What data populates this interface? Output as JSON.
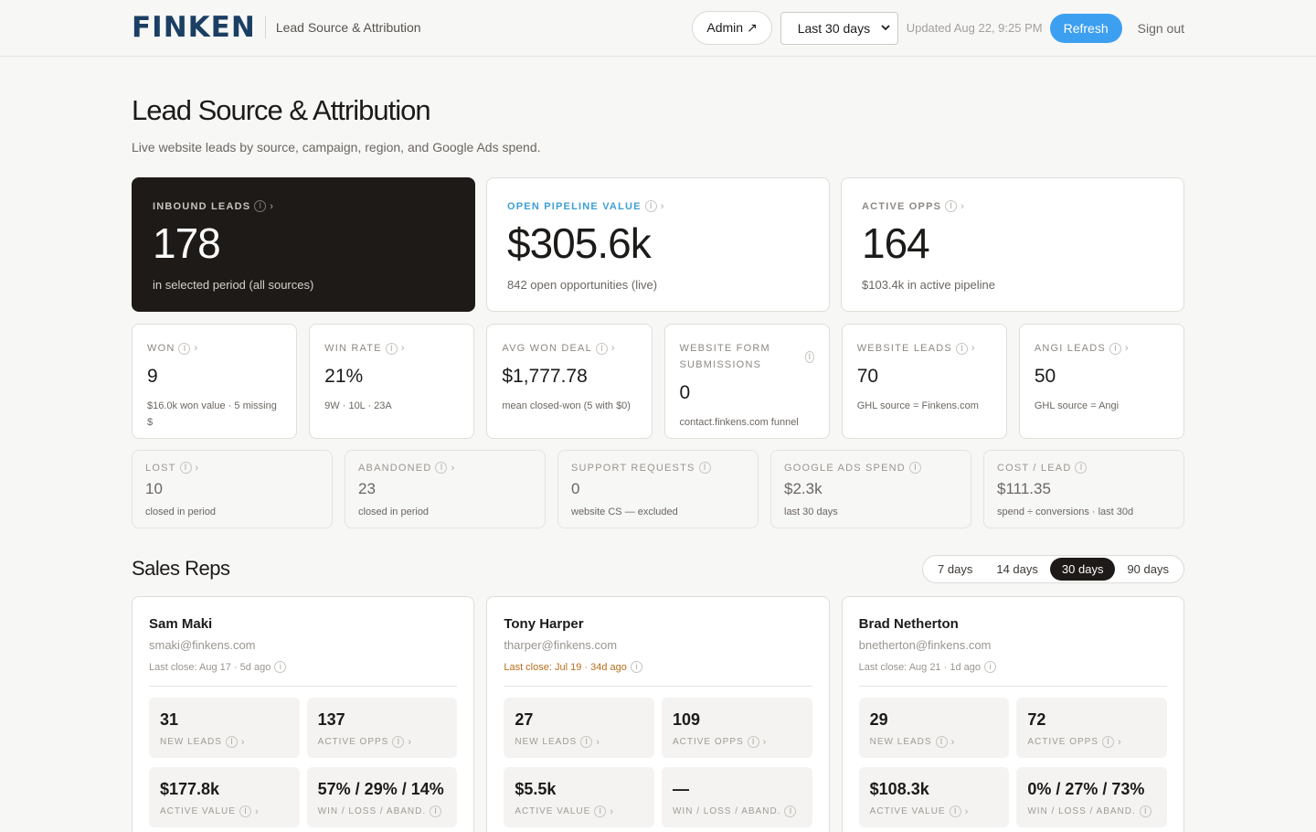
{
  "header": {
    "logo": "FINKEN",
    "subtitle": "Lead Source & Attribution",
    "admin_label": "Admin ↗",
    "period": "Last 30 days",
    "updated": "Updated Aug 22, 9:25 PM",
    "refresh_label": "Refresh",
    "signout_label": "Sign out"
  },
  "page": {
    "title": "Lead Source & Attribution",
    "subtitle": "Live website leads by source, campaign, region, and Google Ads spend."
  },
  "hero": [
    {
      "label": "Inbound Leads",
      "value": "178",
      "note": "in selected period (all sources)"
    },
    {
      "label": "Open Pipeline Value",
      "value": "$305.6k",
      "note": "842 open opportunities (live)"
    },
    {
      "label": "Active Opps",
      "value": "164",
      "note": "$103.4k in active pipeline"
    }
  ],
  "stats": [
    {
      "label": "Won",
      "value": "9",
      "note": "$16.0k won value · 5 missing $"
    },
    {
      "label": "Win Rate",
      "value": "21%",
      "note": "9W · 10L · 23A"
    },
    {
      "label": "Avg Won Deal",
      "value": "$1,777.78",
      "note": "mean closed-won (5 with $0)"
    },
    {
      "label": "Website Form Submissions",
      "value": "0",
      "note": "contact.finkens.com funnel"
    },
    {
      "label": "Website Leads",
      "value": "70",
      "note": "GHL source = Finkens.com"
    },
    {
      "label": "Angi Leads",
      "value": "50",
      "note": "GHL source = Angi"
    }
  ],
  "minis": [
    {
      "label": "Lost",
      "value": "10",
      "note": "closed in period"
    },
    {
      "label": "Abandoned",
      "value": "23",
      "note": "closed in period"
    },
    {
      "label": "Support Requests",
      "value": "0",
      "note": "website CS — excluded"
    },
    {
      "label": "Google Ads Spend",
      "value": "$2.3k",
      "note": "last 30 days"
    },
    {
      "label": "Cost / Lead",
      "value": "$111.35",
      "note": "spend ÷ conversions · last 30d"
    }
  ],
  "reps_section": {
    "title": "Sales Reps",
    "ranges": [
      "7 days",
      "14 days",
      "30 days",
      "90 days"
    ],
    "active_range": "30 days"
  },
  "kpi_labels": {
    "new_leads": "New Leads",
    "active_opps": "Active Opps",
    "active_value": "Active Value",
    "win_loss": "Win / Loss / Aband."
  },
  "reps": [
    {
      "name": "Sam Maki",
      "email": "smaki@finkens.com",
      "last_close": "Last close: Aug 17 · 5d ago",
      "new_leads": "31",
      "active_opps": "137",
      "active_value": "$177.8k",
      "win_loss": "57% / 29% / 14%"
    },
    {
      "name": "Tony Harper",
      "email": "tharper@finkens.com",
      "last_close": "Last close: Jul 19 · 34d ago",
      "new_leads": "27",
      "active_opps": "109",
      "active_value": "$5.5k",
      "win_loss": "—"
    },
    {
      "name": "Brad Netherton",
      "email": "bnetherton@finkens.com",
      "last_close": "Last close: Aug 21 · 1d ago",
      "new_leads": "29",
      "active_opps": "72",
      "active_value": "$108.3k",
      "win_loss": "0% / 27% / 73%"
    }
  ],
  "colors": {
    "accent": "#3d9ff0",
    "dark_card": "#1e1a17",
    "logo": "#1b3f63",
    "warn": "#b86e1c"
  }
}
